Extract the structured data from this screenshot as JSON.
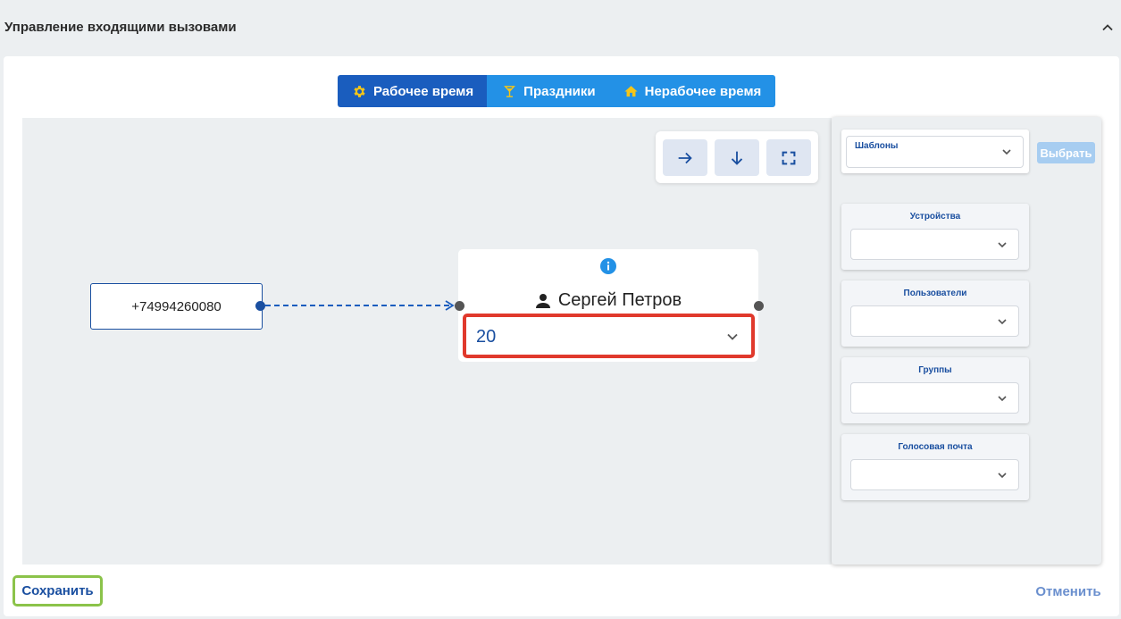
{
  "header": {
    "title": "Управление входящими вызовами"
  },
  "tabs": [
    {
      "label": "Рабочее время",
      "icon": "gear-icon",
      "active": true
    },
    {
      "label": "Праздники",
      "icon": "cocktail-icon",
      "active": false
    },
    {
      "label": "Нерабочее время",
      "icon": "home-icon",
      "active": false
    }
  ],
  "canvas_controls": [
    {
      "icon": "arrow-right-icon"
    },
    {
      "icon": "arrow-down-icon"
    },
    {
      "icon": "fullscreen-icon"
    }
  ],
  "flow": {
    "source_number": "+74994260080",
    "target": {
      "name": "Сергей Петров",
      "ring_time": "20"
    }
  },
  "side_panel": {
    "templates": {
      "label": "Шаблоны",
      "button": "Выбрать"
    },
    "groups": [
      {
        "label": "Устройства"
      },
      {
        "label": "Пользователи"
      },
      {
        "label": "Группы"
      },
      {
        "label": "Голосовая почта"
      }
    ]
  },
  "actions": {
    "save": "Сохранить",
    "cancel": "Отменить"
  },
  "colors": {
    "primary": "#1a5dbe",
    "tab_inactive": "#2391e6",
    "highlight_red": "#e0392c",
    "highlight_green": "#8bc34a"
  }
}
